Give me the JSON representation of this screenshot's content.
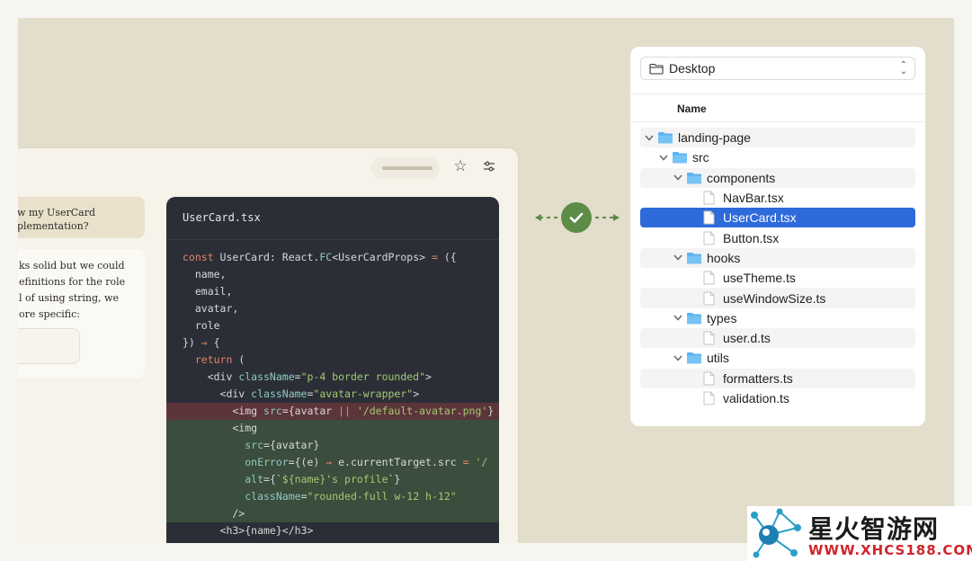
{
  "chat": {
    "user_lines": [
      "w my UserCard",
      "plementation?"
    ],
    "ai_lines": [
      "ks solid but we could",
      "efinitions for the role",
      "l of using string, we",
      "ore specific:"
    ]
  },
  "code": {
    "filename": "UserCard.tsx",
    "lines": [
      {
        "kind": "normal",
        "parts": [
          [
            "k",
            "const "
          ],
          [
            "p",
            "UserCard: React."
          ],
          [
            "t",
            "FC"
          ],
          [
            "p",
            "<UserCardProps> "
          ],
          [
            "k",
            "= "
          ],
          [
            "p",
            "({"
          ]
        ]
      },
      {
        "kind": "normal",
        "parts": [
          [
            "p",
            "  name,"
          ]
        ]
      },
      {
        "kind": "normal",
        "parts": [
          [
            "p",
            "  email,"
          ]
        ]
      },
      {
        "kind": "normal",
        "parts": [
          [
            "p",
            "  avatar,"
          ]
        ]
      },
      {
        "kind": "normal",
        "parts": [
          [
            "p",
            "  role"
          ]
        ]
      },
      {
        "kind": "normal",
        "parts": [
          [
            "p",
            "}) "
          ],
          [
            "k",
            "⇒ "
          ],
          [
            "p",
            "{"
          ]
        ]
      },
      {
        "kind": "normal",
        "parts": [
          [
            "k",
            "  return "
          ],
          [
            "p",
            "("
          ]
        ]
      },
      {
        "kind": "normal",
        "parts": [
          [
            "p",
            "    <div "
          ],
          [
            "t",
            "className"
          ],
          [
            "p",
            "="
          ],
          [
            "s",
            "\"p-4 border rounded\""
          ],
          [
            "p",
            ">"
          ]
        ]
      },
      {
        "kind": "normal",
        "parts": [
          [
            "p",
            "      <div "
          ],
          [
            "t",
            "className"
          ],
          [
            "p",
            "="
          ],
          [
            "s",
            "\"avatar-wrapper\""
          ],
          [
            "p",
            ">"
          ]
        ]
      },
      {
        "kind": "removed",
        "parts": [
          [
            "p",
            "        <img "
          ],
          [
            "t",
            "src"
          ],
          [
            "p",
            "={avatar "
          ],
          [
            "k",
            "|| "
          ],
          [
            "s",
            "'/default-avatar.png'"
          ],
          [
            "p",
            "}"
          ]
        ]
      },
      {
        "kind": "added",
        "parts": [
          [
            "p",
            "        <img"
          ]
        ]
      },
      {
        "kind": "added",
        "parts": [
          [
            "t",
            "          src"
          ],
          [
            "p",
            "={avatar}"
          ]
        ]
      },
      {
        "kind": "added",
        "parts": [
          [
            "t",
            "          onError"
          ],
          [
            "p",
            "={(e) "
          ],
          [
            "k",
            "⇒ "
          ],
          [
            "p",
            "e.currentTarget.src "
          ],
          [
            "k",
            "= "
          ],
          [
            "s",
            "'/"
          ]
        ]
      },
      {
        "kind": "added",
        "parts": [
          [
            "t",
            "          alt"
          ],
          [
            "p",
            "={`"
          ],
          [
            "s",
            "${name}'s profile"
          ],
          [
            "p",
            "`}"
          ]
        ]
      },
      {
        "kind": "added",
        "parts": [
          [
            "t",
            "          className"
          ],
          [
            "p",
            "="
          ],
          [
            "s",
            "\"rounded-full w-12 h-12\""
          ]
        ]
      },
      {
        "kind": "added",
        "parts": [
          [
            "p",
            "        />"
          ]
        ]
      },
      {
        "kind": "normal",
        "parts": [
          [
            "p",
            "      <h3>{name}</h3>"
          ]
        ]
      }
    ]
  },
  "file_browser": {
    "location": "Desktop",
    "column_header": "Name",
    "items": [
      {
        "label": "landing-page",
        "type": "folder",
        "depth": 0,
        "expanded": true,
        "selected": false
      },
      {
        "label": "src",
        "type": "folder",
        "depth": 1,
        "expanded": true,
        "selected": false
      },
      {
        "label": "components",
        "type": "folder",
        "depth": 2,
        "expanded": true,
        "selected": false
      },
      {
        "label": "NavBar.tsx",
        "type": "file",
        "depth": 3,
        "selected": false
      },
      {
        "label": "UserCard.tsx",
        "type": "file",
        "depth": 3,
        "selected": true
      },
      {
        "label": "Button.tsx",
        "type": "file",
        "depth": 3,
        "selected": false
      },
      {
        "label": "hooks",
        "type": "folder",
        "depth": 2,
        "expanded": true,
        "selected": false
      },
      {
        "label": "useTheme.ts",
        "type": "file",
        "depth": 3,
        "selected": false
      },
      {
        "label": "useWindowSize.ts",
        "type": "file",
        "depth": 3,
        "selected": false
      },
      {
        "label": "types",
        "type": "folder",
        "depth": 2,
        "expanded": true,
        "selected": false
      },
      {
        "label": "user.d.ts",
        "type": "file",
        "depth": 3,
        "selected": false
      },
      {
        "label": "utils",
        "type": "folder",
        "depth": 2,
        "expanded": true,
        "selected": false
      },
      {
        "label": "formatters.ts",
        "type": "file",
        "depth": 3,
        "selected": false
      },
      {
        "label": "validation.ts",
        "type": "file",
        "depth": 3,
        "selected": false
      }
    ]
  },
  "watermark": {
    "title": "星火智游网",
    "url": "WWW.XHCS188.COM"
  },
  "colors": {
    "background": "#e3ddcb",
    "code_bg": "#2b2e36",
    "selection": "#2d6ada",
    "success": "#5c8c46",
    "folder": "#5ab3f0",
    "diff_removed": "#5c353a",
    "diff_added": "#3b4d3c"
  },
  "icons": {
    "toolbar": [
      "star-icon",
      "sliders-icon"
    ],
    "connector": "check-icon",
    "tree": [
      "folder-icon",
      "file-icon",
      "chevron-down-icon"
    ]
  }
}
